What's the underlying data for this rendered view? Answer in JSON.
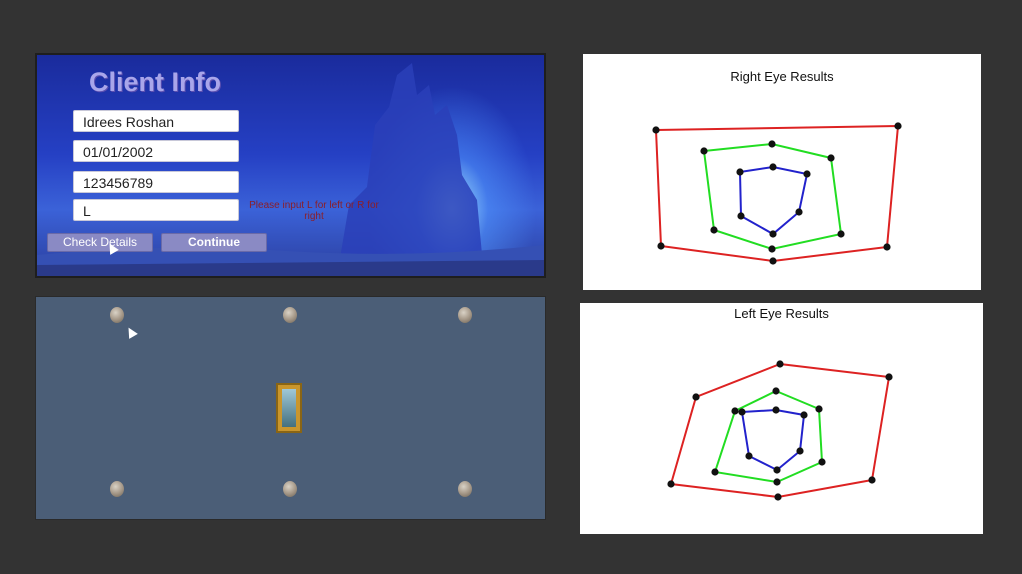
{
  "client_info": {
    "title": "Client Info",
    "fields": [
      {
        "value": "Idrees Roshan"
      },
      {
        "value": "01/01/2002"
      },
      {
        "value": "123456789"
      },
      {
        "value": "L"
      }
    ],
    "hint": "Please input L for left or R for right",
    "check_label": "Check Details",
    "continue_label": "Continue"
  },
  "colors": {
    "outer": "#dd2222",
    "middle": "#22dd22",
    "inner": "#2222cc",
    "point": "#111111"
  },
  "chart_data": [
    {
      "type": "scatter",
      "title": "Right Eye Results",
      "series": [
        {
          "points": [
            [
              73,
              76
            ],
            [
              315,
              72
            ],
            [
              304,
              193
            ],
            [
              190,
              207
            ],
            [
              78,
              192
            ]
          ]
        },
        {
          "points": [
            [
              121,
              97
            ],
            [
              189,
              90
            ],
            [
              248,
              104
            ],
            [
              258,
              180
            ],
            [
              189,
              195
            ],
            [
              131,
              176
            ]
          ]
        },
        {
          "points": [
            [
              157,
              118
            ],
            [
              190,
              113
            ],
            [
              224,
              120
            ],
            [
              216,
              158
            ],
            [
              190,
              180
            ],
            [
              158,
              162
            ]
          ]
        }
      ]
    },
    {
      "type": "scatter",
      "title": "Left Eye Results",
      "series": [
        {
          "points": [
            [
              200,
              61
            ],
            [
              309,
              74
            ],
            [
              292,
              177
            ],
            [
              198,
              194
            ],
            [
              91,
              181
            ],
            [
              116,
              94
            ]
          ]
        },
        {
          "points": [
            [
              196,
              88
            ],
            [
              239,
              106
            ],
            [
              242,
              159
            ],
            [
              197,
              179
            ],
            [
              135,
              169
            ],
            [
              155,
              108
            ]
          ]
        },
        {
          "points": [
            [
              162,
              109
            ],
            [
              196,
              107
            ],
            [
              224,
              112
            ],
            [
              220,
              148
            ],
            [
              197,
              167
            ],
            [
              169,
              153
            ]
          ]
        }
      ]
    }
  ]
}
